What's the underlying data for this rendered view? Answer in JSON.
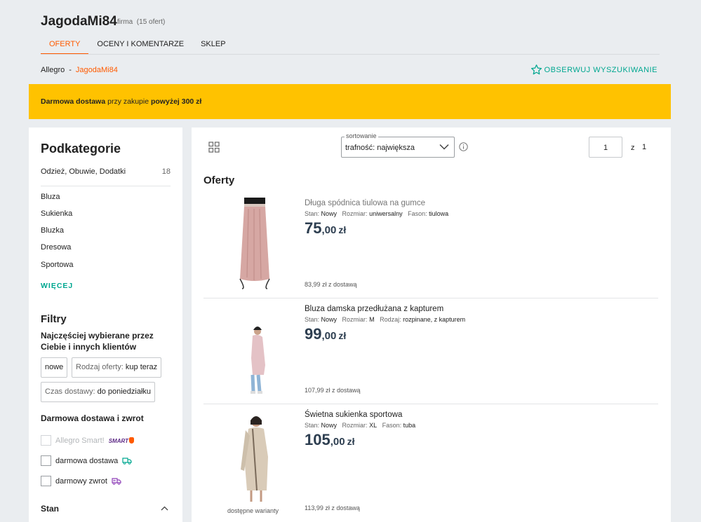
{
  "seller": {
    "name": "JagodaMi84",
    "type": "firma",
    "count": "(15 ofert)"
  },
  "tabs": [
    {
      "label": "OFERTY",
      "active": true
    },
    {
      "label": "OCENY I KOMENTARZE",
      "active": false
    },
    {
      "label": "SKLEP",
      "active": false
    }
  ],
  "breadcrumb": {
    "root": "Allegro",
    "sep": "-",
    "current": "JagodaMi84"
  },
  "observe_label": "OBSERWUJ WYSZUKIWANIE",
  "banner": {
    "part1": "Darmowa dostawa",
    "part2": " przy zakupie ",
    "part3": "powyżej 300 zł"
  },
  "sidebar": {
    "title": "Podkategorie",
    "top_category": {
      "label": "Odzież, Obuwie, Dodatki",
      "count": "18"
    },
    "subcategories": [
      "Bluza",
      "Sukienka",
      "Bluzka",
      "Dresowa",
      "Sportowa"
    ],
    "more_label": "WIĘCEJ",
    "filters_title": "Filtry",
    "filters_subtitle": "Najczęściej wybierane przez Ciebie i innych klientów",
    "chips": [
      {
        "label": "",
        "value": "nowe"
      },
      {
        "label": "Rodzaj oferty: ",
        "value": "kup teraz"
      },
      {
        "label": "Czas dostawy: ",
        "value": "do poniedziałku"
      }
    ],
    "free_delivery_title": "Darmowa dostawa i zwrot",
    "checkboxes": [
      {
        "label": "Allegro Smart!",
        "badge": "SMART",
        "disabled": true
      },
      {
        "label": "darmowa dostawa",
        "disabled": false
      },
      {
        "label": "darmowy zwrot",
        "disabled": false
      }
    ],
    "stan_title": "Stan"
  },
  "toolbar": {
    "sort_legend": "sortowanie",
    "sort_value": "trafność: największa",
    "page_current": "1",
    "page_of": "z",
    "page_total": "1"
  },
  "offers_title": "Oferty",
  "offers": [
    {
      "title": "Długa spódnica tiulowa na gumce",
      "visited": true,
      "params": [
        {
          "k": "Stan: ",
          "v": "Nowy"
        },
        {
          "k": "Rozmiar: ",
          "v": "uniwersalny"
        },
        {
          "k": "Fason: ",
          "v": "tiulowa"
        }
      ],
      "price_int": "75",
      "price_dec": ",00",
      "currency": "zł",
      "delivery": "83,99 zł z dostawą",
      "variants": ""
    },
    {
      "title": "Bluza damska przedłużana z kapturem",
      "visited": false,
      "params": [
        {
          "k": "Stan: ",
          "v": "Nowy"
        },
        {
          "k": "Rozmiar: ",
          "v": "M"
        },
        {
          "k": "Rodzaj: ",
          "v": "rozpinane, z kapturem"
        }
      ],
      "price_int": "99",
      "price_dec": ",00",
      "currency": "zł",
      "delivery": "107,99 zł z dostawą",
      "variants": ""
    },
    {
      "title": "Świetna sukienka sportowa",
      "visited": false,
      "params": [
        {
          "k": "Stan: ",
          "v": "Nowy"
        },
        {
          "k": "Rozmiar: ",
          "v": "XL"
        },
        {
          "k": "Fason: ",
          "v": "tuba"
        }
      ],
      "price_int": "105",
      "price_dec": ",00",
      "currency": "zł",
      "delivery": "113,99 zł z dostawą",
      "variants": "dostępne warianty"
    }
  ],
  "colors": {
    "accent": "#ff5a00",
    "teal": "#00a790",
    "banner": "#ffc200",
    "price": "#2d3e50"
  },
  "icons": [
    "star-outline-icon",
    "grid-view-icon",
    "chevron-down-icon",
    "info-icon",
    "truck-icon",
    "return-truck-icon",
    "chevron-up-icon"
  ]
}
